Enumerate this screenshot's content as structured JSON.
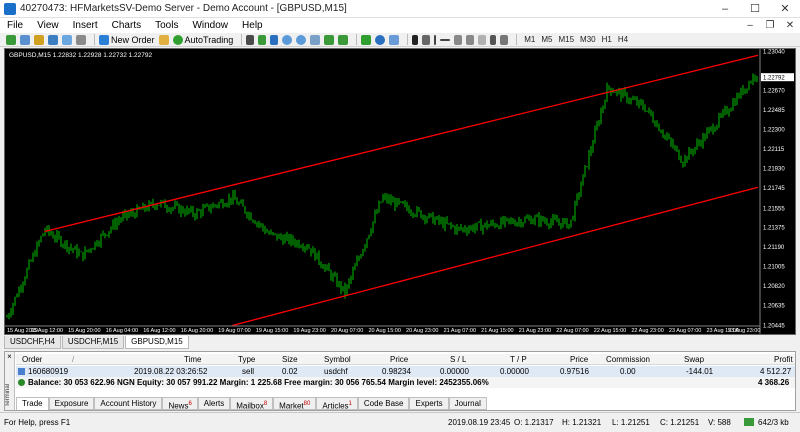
{
  "window": {
    "title": "40270473: HFMarketsSV-Demo Server - Demo Account - [GBPUSD,M15]",
    "minimize": "–",
    "maximize": "☐",
    "close": "✕"
  },
  "menu": {
    "items": [
      "File",
      "View",
      "Insert",
      "Charts",
      "Tools",
      "Window",
      "Help"
    ],
    "mdi": [
      "–",
      "❐",
      "✕"
    ]
  },
  "toolbar": {
    "new_order": "New Order",
    "auto_trading": "AutoTrading",
    "timeframes": [
      "M1",
      "M5",
      "M15",
      "M30",
      "H1",
      "H4"
    ]
  },
  "chart": {
    "label": "GBPUSD,M15  1.22832 1.22928 1.22732 1.22792",
    "current_price": "1.22792",
    "price_ticks": [
      "1.23040",
      "1.22792",
      "1.22670",
      "1.22485",
      "1.22300",
      "1.22115",
      "1.21930",
      "1.21745",
      "1.21555",
      "1.21375",
      "1.21190",
      "1.21005",
      "1.20820",
      "1.20635",
      "1.20445"
    ],
    "time_ticks": [
      "15 Aug 2019",
      "15 Aug 12:00",
      "15 Aug 20:00",
      "16 Aug 04:00",
      "16 Aug 12:00",
      "16 Aug 20:00",
      "19 Aug 07:00",
      "19 Aug 15:00",
      "19 Aug 23:00",
      "20 Aug 07:00",
      "20 Aug 15:00",
      "20 Aug 23:00",
      "21 Aug 07:00",
      "21 Aug 15:00",
      "21 Aug 23:00",
      "22 Aug 07:00",
      "22 Aug 15:00",
      "22 Aug 23:00",
      "23 Aug 07:00",
      "23 Aug 15:00",
      "23 Aug 23:00"
    ],
    "colors": {
      "background": "#000000",
      "candles": "#00c000",
      "trendline": "#ff0000",
      "axis_text": "#ffffff"
    }
  },
  "chart_data": {
    "type": "line",
    "ylim": [
      1.20445,
      1.2304
    ],
    "x": [
      "15 Aug 2019",
      "15 Aug 12:00",
      "15 Aug 20:00",
      "16 Aug 04:00",
      "16 Aug 12:00",
      "16 Aug 20:00",
      "19 Aug 07:00",
      "19 Aug 15:00",
      "19 Aug 23:00",
      "20 Aug 07:00",
      "20 Aug 15:00",
      "20 Aug 23:00",
      "21 Aug 07:00",
      "21 Aug 15:00",
      "21 Aug 23:00",
      "22 Aug 07:00",
      "22 Aug 15:00",
      "22 Aug 23:00",
      "23 Aug 07:00",
      "23 Aug 15:00",
      "23 Aug 23:00"
    ],
    "series": [
      {
        "values": [
          1.2052,
          1.2135,
          1.211,
          1.2145,
          1.216,
          1.215,
          1.2165,
          1.213,
          1.212,
          1.2075,
          1.2165,
          1.215,
          1.2135,
          1.214,
          1.2145,
          1.214,
          1.227,
          1.225,
          1.22,
          1.224,
          1.2285
        ]
      }
    ],
    "trendlines": [
      {
        "from": [
          "15 Aug 12:00",
          1.2133
        ],
        "to": [
          "23 Aug 23:00",
          1.23
        ]
      },
      {
        "from": [
          "19 Aug 07:00",
          1.2044
        ],
        "to": [
          "23 Aug 23:00",
          1.2175
        ]
      }
    ]
  },
  "chart_tabs": [
    "USDCHF,H4",
    "USDCHF,M15",
    "GBPUSD,M15"
  ],
  "terminal": {
    "close": "×",
    "side_label": "Terminal",
    "headers": [
      "Order",
      "/",
      "Time",
      "Type",
      "Size",
      "Symbol",
      "Price",
      "S / L",
      "T / P",
      "Price",
      "Commission",
      "Swap",
      "Profit"
    ],
    "rows": [
      [
        "160680919",
        "2019.08.22 03:26:52",
        "sell",
        "0.02",
        "usdchf",
        "0.98234",
        "0.00000",
        "0.00000",
        "0.97516",
        "0.00",
        "-144.01",
        "4 512.27"
      ]
    ],
    "balance": "Balance: 30 053 622.96 NGN  Equity: 30 057 991.22  Margin: 1 225.68  Free margin: 30 056 765.54  Margin level: 2452355.06%",
    "balance_profit": "4 368.26",
    "tabs": [
      {
        "label": "Trade",
        "badge": ""
      },
      {
        "label": "Exposure",
        "badge": ""
      },
      {
        "label": "Account History",
        "badge": ""
      },
      {
        "label": "News",
        "badge": "6"
      },
      {
        "label": "Alerts",
        "badge": ""
      },
      {
        "label": "Mailbox",
        "badge": "8"
      },
      {
        "label": "Market",
        "badge": "80"
      },
      {
        "label": "Articles",
        "badge": "1"
      },
      {
        "label": "Code Base",
        "badge": ""
      },
      {
        "label": "Experts",
        "badge": ""
      },
      {
        "label": "Journal",
        "badge": ""
      }
    ]
  },
  "status": {
    "help": "For Help, press F1",
    "datetime": "2019.08.19 23:45",
    "open": "O: 1.21317",
    "high": "H: 1.21321",
    "low": "L: 1.21251",
    "close": "C: 1.21251",
    "volume": "V: 588",
    "traffic": "642/3 kb"
  }
}
